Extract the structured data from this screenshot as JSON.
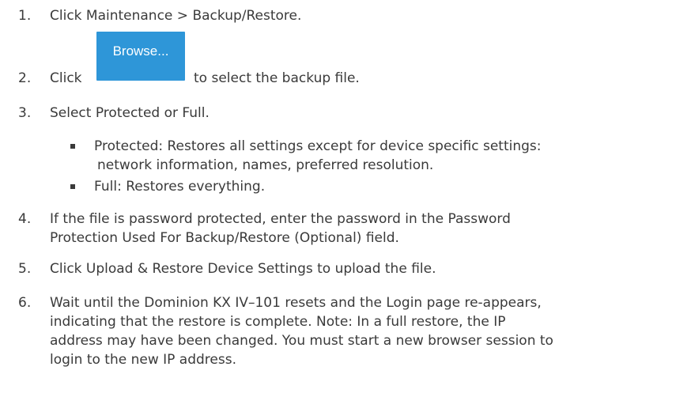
{
  "steps": [
    {
      "num": "1.",
      "lines": [
        "Click Maintenance > Backup/Restore."
      ]
    },
    {
      "num": "2.",
      "prefix": "Click",
      "button_label": "Browse...",
      "suffix": "to select the backup file."
    },
    {
      "num": "3.",
      "lines": [
        "Select Protected or Full."
      ],
      "sub": [
        {
          "lines": [
            "Protected: Restores all settings except for device specific settings:",
            "network information, names, preferred resolution."
          ]
        },
        {
          "lines": [
            "Full: Restores everything."
          ]
        }
      ]
    },
    {
      "num": "4.",
      "lines": [
        "If the file is password protected, enter the password in the Password",
        "Protection Used For Backup/Restore (Optional) field."
      ]
    },
    {
      "num": "5.",
      "lines": [
        "Click Upload & Restore Device Settings to upload the file."
      ]
    },
    {
      "num": "6.",
      "lines": [
        "Wait until the Dominion KX IV–101 resets and the Login page re-appears,",
        "indicating that the restore is complete. Note: In a full restore, the IP",
        "address may have been changed. You must start a new browser session to",
        "login to the new IP address."
      ]
    }
  ]
}
